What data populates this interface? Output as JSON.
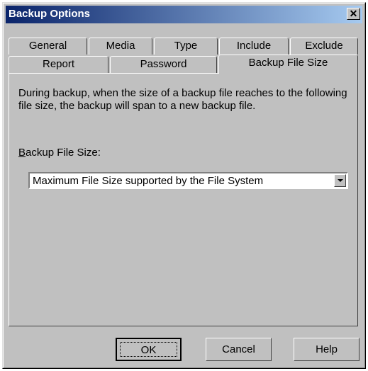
{
  "window": {
    "title": "Backup Options",
    "close_glyph": "✕",
    "title_gradient": [
      "#0a246a",
      "#a6caf0"
    ]
  },
  "tabs": {
    "row_back": [
      "General",
      "Media",
      "Type",
      "Include",
      "Exclude"
    ],
    "row_front": [
      "Report",
      "Password",
      "Backup File Size"
    ],
    "active": "Backup File Size"
  },
  "panel": {
    "description": "During backup, when the size of a backup file reaches to the following file size, the backup will span to a new backup file.",
    "field_label_accel": "B",
    "field_label_rest": "ackup File Size:",
    "select_value": "Maximum File Size supported by the File System"
  },
  "buttons": {
    "ok": "OK",
    "cancel": "Cancel",
    "help": "Help"
  }
}
